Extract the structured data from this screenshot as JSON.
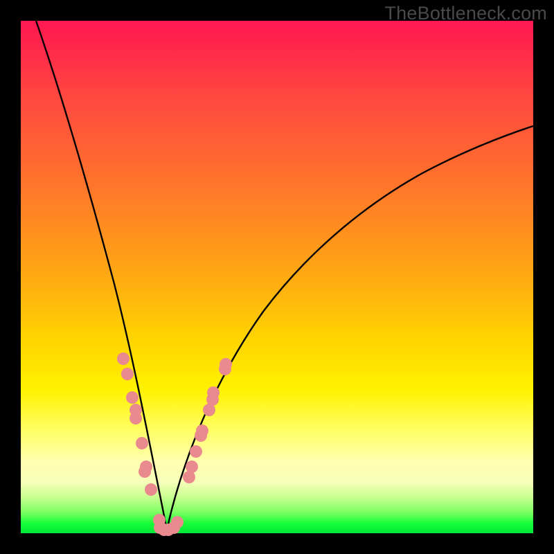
{
  "watermark": "TheBottleneck.com",
  "chart_data": {
    "type": "line",
    "title": "",
    "xlabel": "",
    "ylabel": "",
    "xlim": [
      0,
      100
    ],
    "ylim": [
      0,
      100
    ],
    "grid": false,
    "legend": false,
    "series": [
      {
        "name": "bottleneck-curve",
        "color": "#000000",
        "x": [
          3,
          6,
          10,
          14,
          18,
          21,
          23.5,
          25.5,
          27,
          28.5,
          30,
          32,
          35,
          40,
          47,
          55,
          65,
          80,
          100
        ],
        "y": [
          100,
          89,
          75,
          60,
          44,
          30,
          18,
          9,
          3,
          0.6,
          2,
          8,
          18,
          32,
          46,
          57,
          66,
          74,
          80
        ]
      },
      {
        "name": "datapoints-left",
        "type": "scatter",
        "color": "#e98a8f",
        "x": [
          20.0,
          20.8,
          21.8,
          22.4,
          22.4,
          23.6,
          24.4,
          24.2,
          25.4,
          27.0
        ],
        "y": [
          34,
          31,
          26.5,
          24,
          22.4,
          17.5,
          13,
          12,
          8.5,
          2.5
        ]
      },
      {
        "name": "datapoints-bottom",
        "type": "scatter",
        "color": "#e98a8f",
        "x": [
          27.2,
          28.0,
          28.7,
          29.9,
          30.6
        ],
        "y": [
          1.0,
          0.6,
          0.6,
          1.0,
          2.2
        ]
      },
      {
        "name": "datapoints-right",
        "type": "scatter",
        "color": "#e98a8f",
        "x": [
          32.8,
          33.4,
          34.2,
          35.2,
          35.4,
          36.8,
          37.4,
          37.6,
          39.8,
          40.0
        ],
        "y": [
          11,
          13,
          16,
          19,
          20,
          24,
          26,
          27.5,
          32,
          33
        ]
      }
    ]
  }
}
